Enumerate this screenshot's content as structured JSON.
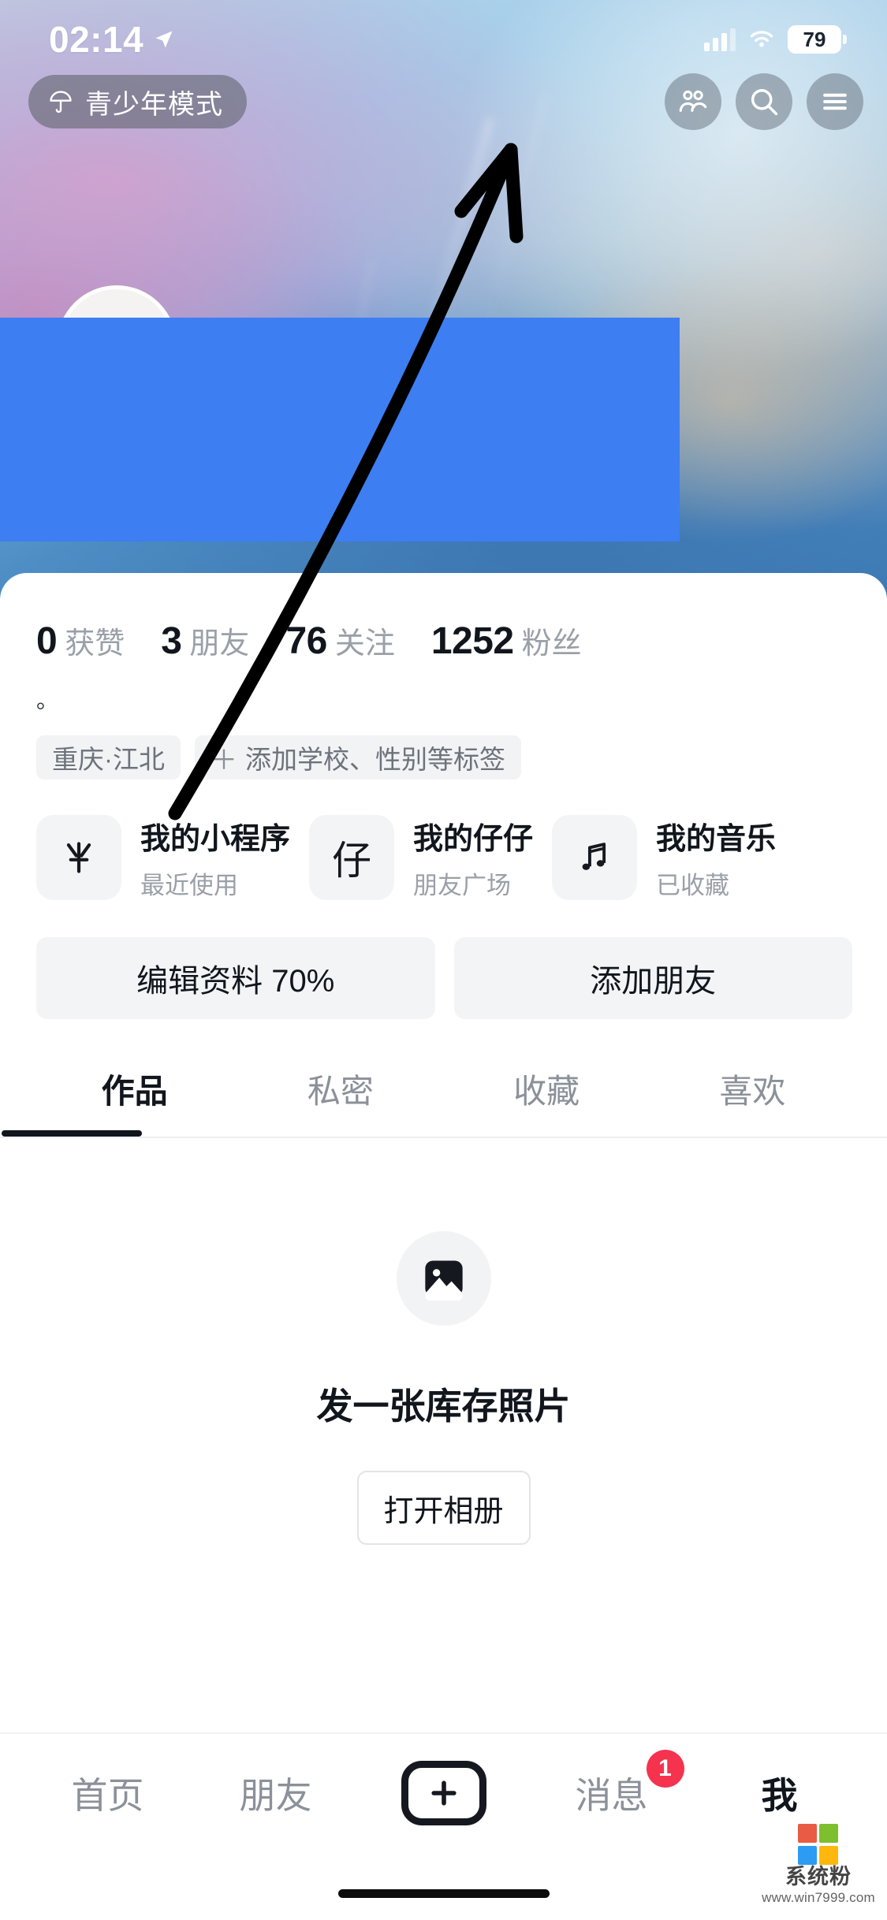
{
  "status_bar": {
    "time": "02:14",
    "battery": "79",
    "location_icon": "location-arrow-icon",
    "signal_icon": "cellular-signal-icon",
    "wifi_icon": "wifi-icon"
  },
  "header": {
    "teen_mode_label": "青少年模式",
    "teen_mode_icon": "umbrella-icon",
    "actions": [
      {
        "name": "friends-icon",
        "label": "朋友"
      },
      {
        "name": "search-icon",
        "label": "搜索"
      },
      {
        "name": "menu-icon",
        "label": "菜单"
      }
    ]
  },
  "profile": {
    "stats": [
      {
        "value": "0",
        "label": "获赞"
      },
      {
        "value": "3",
        "label": "朋友"
      },
      {
        "value": "76",
        "label": "关注"
      },
      {
        "value": "1252",
        "label": "粉丝"
      }
    ],
    "bio": "。",
    "tags": [
      {
        "text": "重庆·江北",
        "has_plus": false
      },
      {
        "text": "添加学校、性别等标签",
        "has_plus": true,
        "plus": "＋"
      }
    ],
    "shortcuts": [
      {
        "icon": "mini-program-icon",
        "title": "我的小程序",
        "subtitle": "最近使用"
      },
      {
        "icon": "zaizai-icon",
        "title": "我的仔仔",
        "subtitle": "朋友广场",
        "icon_text": "仔"
      },
      {
        "icon": "music-note-icon",
        "title": "我的音乐",
        "subtitle": "已收藏"
      }
    ],
    "actions": [
      {
        "label": "编辑资料 70%"
      },
      {
        "label": "添加朋友"
      }
    ]
  },
  "content_tabs": {
    "items": [
      {
        "label": "作品",
        "active": true
      },
      {
        "label": "私密",
        "active": false
      },
      {
        "label": "收藏",
        "active": false
      },
      {
        "label": "喜欢",
        "active": false
      }
    ]
  },
  "empty_state": {
    "icon": "image-placeholder-icon",
    "title": "发一张库存照片",
    "button_label": "打开相册"
  },
  "bottom_nav": {
    "items": [
      {
        "label": "首页",
        "active": false,
        "badge": null
      },
      {
        "label": "朋友",
        "active": false,
        "badge": null
      },
      {
        "label": "",
        "active": false,
        "badge": null,
        "icon": "plus-icon"
      },
      {
        "label": "消息",
        "active": false,
        "badge": "1"
      },
      {
        "label": "我",
        "active": true,
        "badge": null
      }
    ]
  },
  "watermark": {
    "name": "系统粉",
    "url": "www.win7999.com",
    "colors": [
      "#e8533a",
      "#76bc21",
      "#2196f3",
      "#ffb400"
    ]
  },
  "colors": {
    "accent_blue": "#3d7ef2",
    "badge_red": "#f5334f",
    "text_primary": "#11161d",
    "text_muted": "#9aa0a8",
    "chip_bg": "#f2f3f5"
  }
}
